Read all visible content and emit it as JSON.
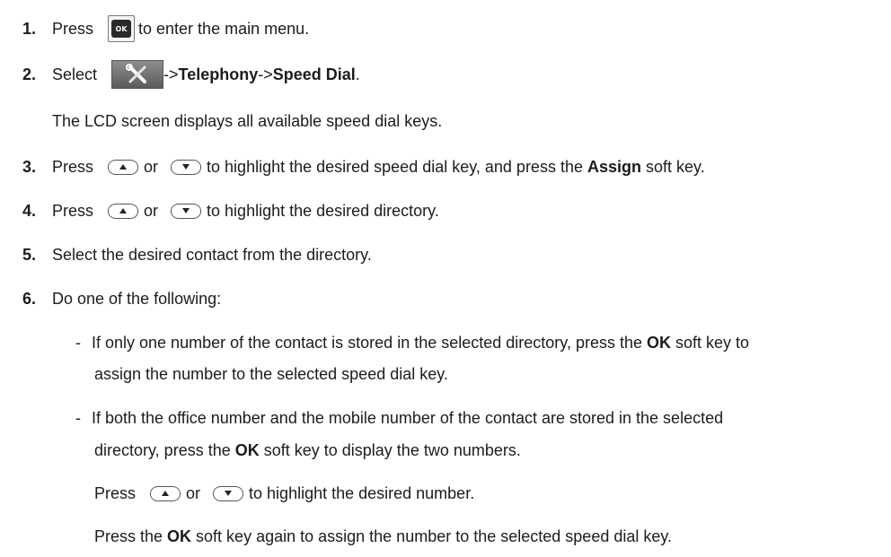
{
  "steps": [
    {
      "num": "1.",
      "pre": "Press",
      "post": "to enter the main menu."
    },
    {
      "num": "2.",
      "pre": "Select",
      "post1": "->",
      "bold1": "Telephony",
      "post2": "->",
      "bold2": "Speed Dial",
      "post3": "."
    },
    {
      "note": "The LCD screen displays all available speed dial keys."
    },
    {
      "num": "3.",
      "pre": "Press",
      "or": "or",
      "post1": "to highlight the desired speed dial key, and press the ",
      "bold": "Assign",
      "post2": " soft key."
    },
    {
      "num": "4.",
      "pre": "Press",
      "or": "or",
      "post": "to highlight the desired directory."
    },
    {
      "num": "5.",
      "text": "Select the desired contact from the directory."
    },
    {
      "num": "6.",
      "text": "Do one of the following:"
    }
  ],
  "bullets": [
    {
      "dash": "-",
      "line1a": "If only one number of the contact is stored in the selected directory, press the ",
      "bold": "OK",
      "line1b": " soft key to",
      "line2": "assign the number to the selected speed dial key."
    },
    {
      "dash": "-",
      "line1": "If both the office number and the mobile number of the contact are stored in the selected",
      "line2a": "directory, press the ",
      "bold": "OK",
      "line2b": " soft key to display the two numbers."
    }
  ],
  "sub_press": {
    "pre": "Press",
    "or": "or",
    "post": "to highlight the desired number."
  },
  "sub_final": {
    "pre": "Press the ",
    "bold": "OK",
    "post": " soft key again to assign the number to the selected speed dial key."
  },
  "icons": {
    "ok_key_label": "OK",
    "menu_icon": "tools-icon",
    "up_icon": "up-arrow-key-icon",
    "down_icon": "down-arrow-key-icon"
  }
}
